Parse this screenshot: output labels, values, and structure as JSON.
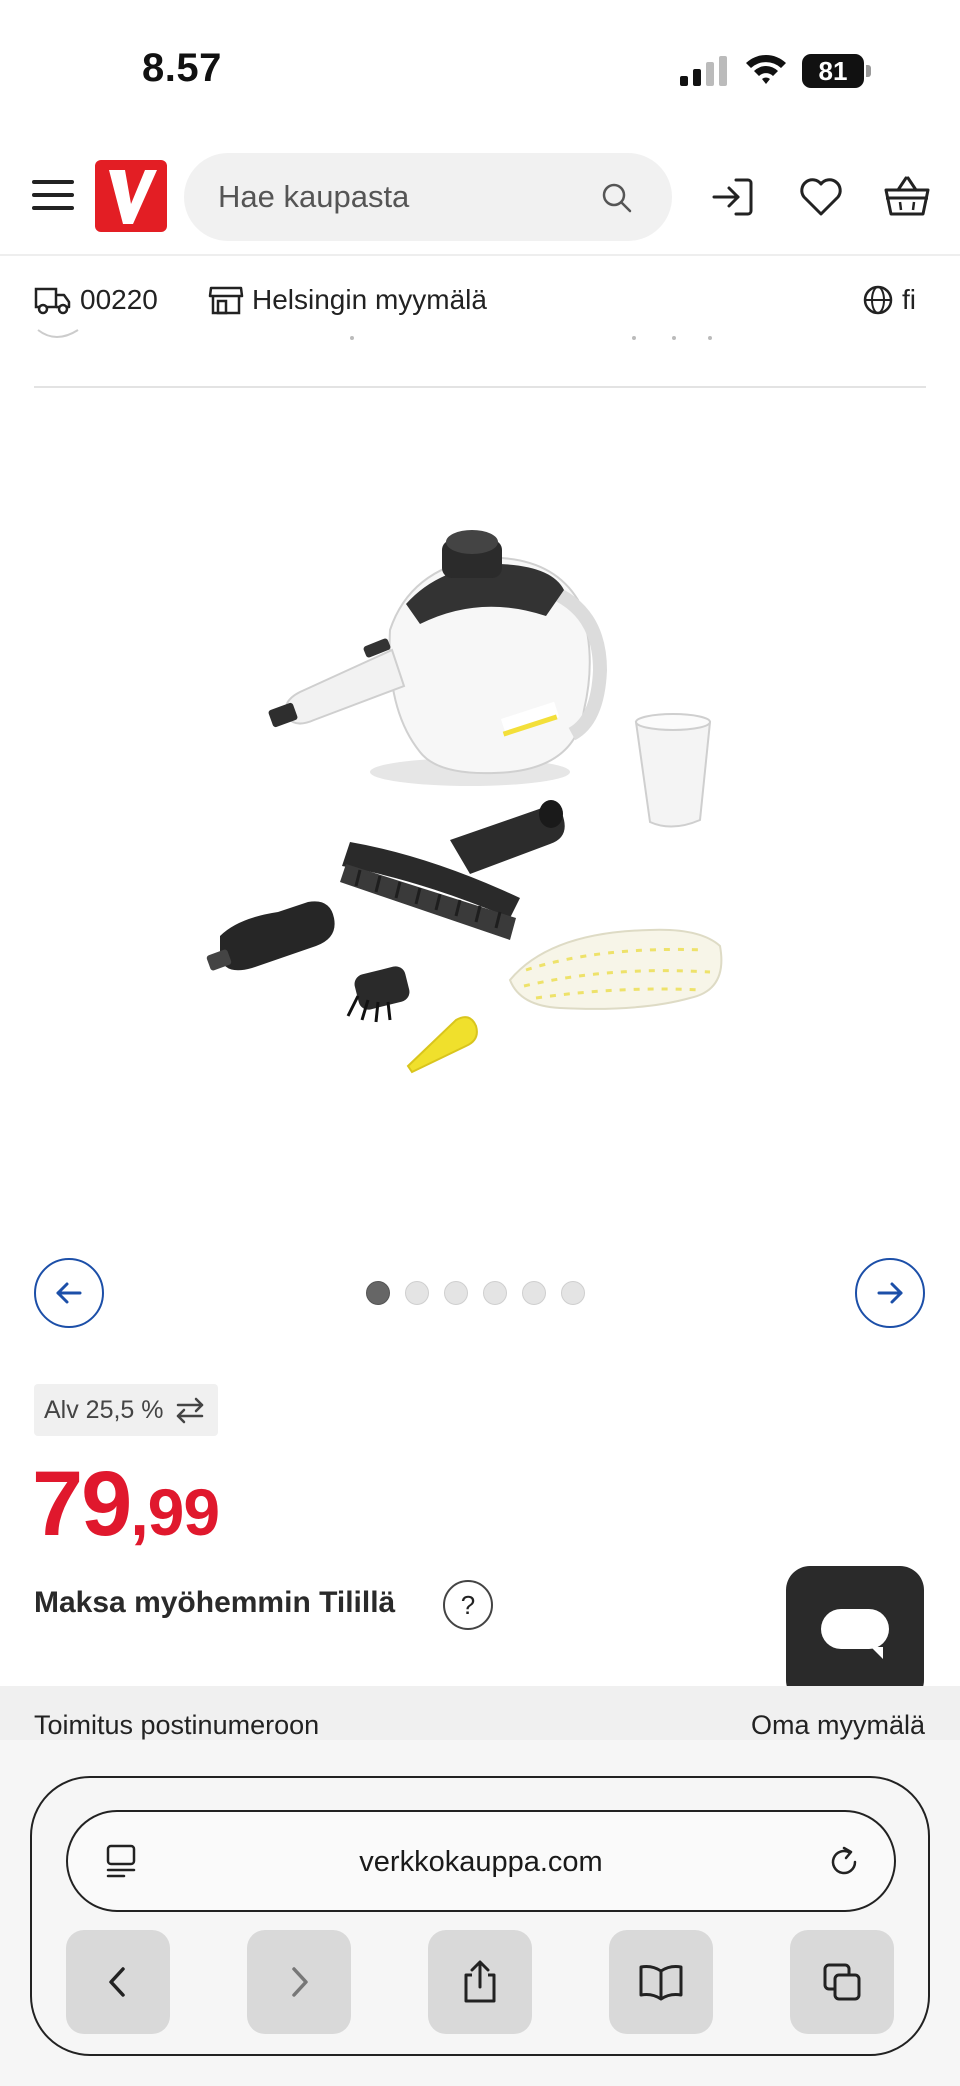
{
  "status_bar": {
    "time": "8.57",
    "battery": "81"
  },
  "header": {
    "logo_letter": "V",
    "search_placeholder": "Hae kaupasta",
    "icons": [
      "menu-icon",
      "search-icon",
      "login-icon",
      "heart-icon",
      "basket-icon"
    ]
  },
  "location_bar": {
    "postal_code": "00220",
    "store": "Helsingin myymälä",
    "language": "fi"
  },
  "gallery": {
    "image_count": 6,
    "active_index": 0
  },
  "price": {
    "vat_label": "Alv 25,5 %",
    "integer": "79",
    "decimals": ",99",
    "color": "#e0182d"
  },
  "pay_later": {
    "label": "Maksa myöhemmin Tilillä",
    "help": "?"
  },
  "delivery": {
    "left_label": "Toimitus postinumeroon",
    "right_label": "Oma myymälä"
  },
  "browser": {
    "url": "verkkokauppa.com"
  },
  "colors": {
    "brand_red": "#e31e24",
    "accent_blue": "#1c4fa8",
    "chat_bg": "#2a2a2a"
  }
}
